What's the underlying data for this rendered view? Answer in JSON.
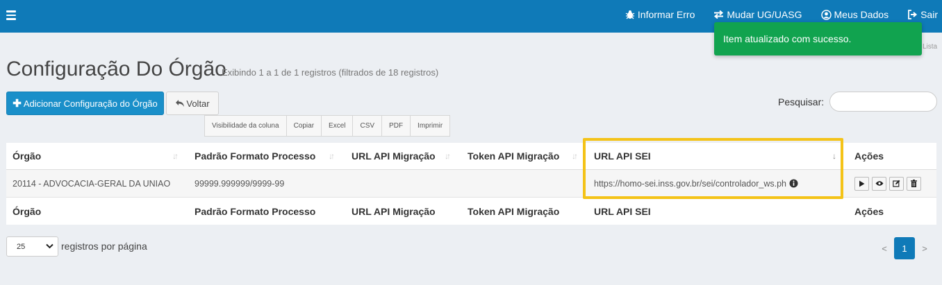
{
  "topbar": {
    "nav": [
      {
        "label": "Informar Erro",
        "icon": "bug-icon"
      },
      {
        "label": "Mudar UG/UASG",
        "icon": "exchange-icon"
      },
      {
        "label": "Meus Dados",
        "icon": "user-circle-icon"
      },
      {
        "label": "Sair",
        "icon": "sign-out-icon"
      }
    ]
  },
  "toast": {
    "message": "Item atualizado com sucesso.",
    "partial_text": "Lista"
  },
  "page": {
    "title": "Configuração Do Órgão",
    "subtitle": "Exibindo 1 a 1 de 1 registros (filtrados de 18 registros)"
  },
  "toolbar": {
    "add_label": "Adicionar Configuração do Órgão",
    "back_label": "Voltar",
    "exports": [
      "Visibilidade da coluna",
      "Copiar",
      "Excel",
      "CSV",
      "PDF",
      "Imprimir"
    ],
    "search_label": "Pesquisar:",
    "search_value": ""
  },
  "table": {
    "columns": [
      "Órgão",
      "Padrão Formato Processo",
      "URL API Migração",
      "Token API Migração",
      "URL API SEI",
      "Ações"
    ],
    "rows": [
      {
        "orgao": "20114 - ADVOCACIA-GERAL DA UNIAO",
        "padrao": "99999.999999/9999-99",
        "url_migracao": "",
        "token_migracao": "",
        "url_sei": "https://homo-sei.inss.gov.br/sei/controlador_ws.ph"
      }
    ]
  },
  "footer": {
    "per_page_value": "25",
    "per_page_label": "registros por página",
    "prev": "<",
    "current_page": "1",
    "next": ">"
  },
  "colors": {
    "topbar": "#0f7ab8",
    "primary": "#1a8fc9",
    "success": "#11a34f",
    "highlight": "#f4c318"
  }
}
